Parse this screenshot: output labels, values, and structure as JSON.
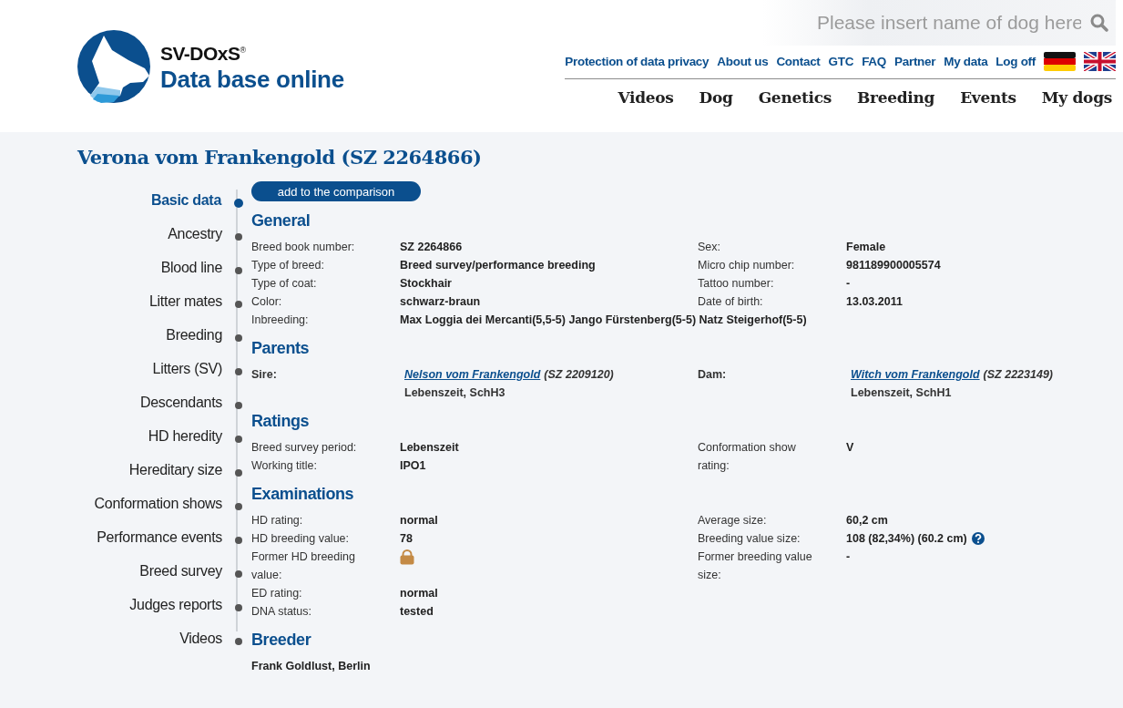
{
  "logo": {
    "brand": "SV-DOxS$^{®}$",
    "subtitle": "Data base online"
  },
  "search": {
    "placeholder": "Please insert name of dog here"
  },
  "top_links": [
    "Protection of data privacy",
    "About us",
    "Contact",
    "GTC",
    "FAQ",
    "Partner",
    "My data",
    "Log off"
  ],
  "languages": [
    {
      "kind": "de"
    },
    {
      "kind": "en"
    }
  ],
  "main_nav": [
    "Videos",
    "Dog",
    "Genetics",
    "Breeding",
    "Events",
    "My dogs"
  ],
  "title": "Verona vom Frankengold (SZ 2264866)",
  "compare_button": "add to the comparison",
  "sidebar": [
    {
      "label": "Basic data",
      "selected": true
    },
    {
      "label": "Ancestry",
      "selected": false
    },
    {
      "label": "Blood line",
      "selected": false
    },
    {
      "label": "Litter mates",
      "selected": false
    },
    {
      "label": "Breeding",
      "selected": false
    },
    {
      "label": "Litters (SV)",
      "selected": false
    },
    {
      "label": "Descendants",
      "selected": false
    },
    {
      "label": "HD heredity",
      "selected": false
    },
    {
      "label": "Hereditary size",
      "selected": false
    },
    {
      "label": "Conformation shows",
      "selected": false
    },
    {
      "label": "Performance events",
      "selected": false
    },
    {
      "label": "Breed survey",
      "selected": false
    },
    {
      "label": "Judges reports",
      "selected": false
    },
    {
      "label": "Videos",
      "selected": false
    }
  ],
  "sections": [
    {
      "heading": "General",
      "kind": "fields",
      "left": [
        {
          "kind": "text",
          "label": "Breed book number:",
          "value": "SZ 2264866"
        },
        {
          "kind": "text",
          "label": "Type of breed:",
          "value": "Breed survey/performance breeding"
        },
        {
          "kind": "text",
          "label": "Type of coat:",
          "value": "Stockhair"
        },
        {
          "kind": "text",
          "label": "Color:",
          "value": "schwarz-braun"
        },
        {
          "kind": "text",
          "label": "Inbreeding:",
          "value": "Max Loggia dei Mercanti(5,5-5) Jango Fürstenberg(5-5) Natz Steigerhof(5-5)"
        }
      ],
      "right": [
        {
          "kind": "text",
          "label": "Sex:",
          "value": "Female"
        },
        {
          "kind": "text",
          "label": "Micro chip number:",
          "value": "981189900005574"
        },
        {
          "kind": "text",
          "label": "Tattoo number:",
          "value": "-"
        },
        {
          "kind": "text",
          "label": "Date of birth:",
          "value": "13.03.2011"
        }
      ]
    },
    {
      "heading": "Parents",
      "kind": "fields",
      "left": [
        {
          "kind": "parent",
          "label": "Sire:",
          "name": "Nelson vom Frankengold",
          "registration": "(SZ 2209120)",
          "note": "Lebenszeit, SchH3"
        }
      ],
      "right": [
        {
          "kind": "parent",
          "label": "Dam:",
          "name": "Witch vom Frankengold",
          "registration": "(SZ 2223149)",
          "note": "Lebenszeit, SchH1"
        }
      ]
    },
    {
      "heading": "Ratings",
      "kind": "fields",
      "left": [
        {
          "kind": "text",
          "label": "Breed survey period:",
          "value": "Lebenszeit"
        },
        {
          "kind": "text",
          "label": "Working title:",
          "value": "IPO1"
        }
      ],
      "right": [
        {
          "kind": "text",
          "label": "Conformation show rating:",
          "value": "V"
        }
      ]
    },
    {
      "heading": "Examinations",
      "kind": "fields",
      "left": [
        {
          "kind": "text",
          "label": "HD rating:",
          "value": "normal"
        },
        {
          "kind": "text",
          "label": "HD breeding value:",
          "value": "78"
        },
        {
          "kind": "locked",
          "label": "Former HD breeding value:"
        },
        {
          "kind": "text",
          "label": "ED rating:",
          "value": "normal"
        },
        {
          "kind": "text",
          "label": "DNA status:",
          "value": "tested"
        }
      ],
      "right": [
        {
          "kind": "text",
          "label": "Average size:",
          "value": "60,2 cm"
        },
        {
          "kind": "help",
          "label": "Breeding value size:",
          "value": "108 (82,34%) (60.2 cm)"
        },
        {
          "kind": "text",
          "label": "Former breeding value size:",
          "value": "-"
        }
      ]
    },
    {
      "heading": "Breeder",
      "kind": "text",
      "text": "Frank Goldlust, Berlin"
    }
  ]
}
